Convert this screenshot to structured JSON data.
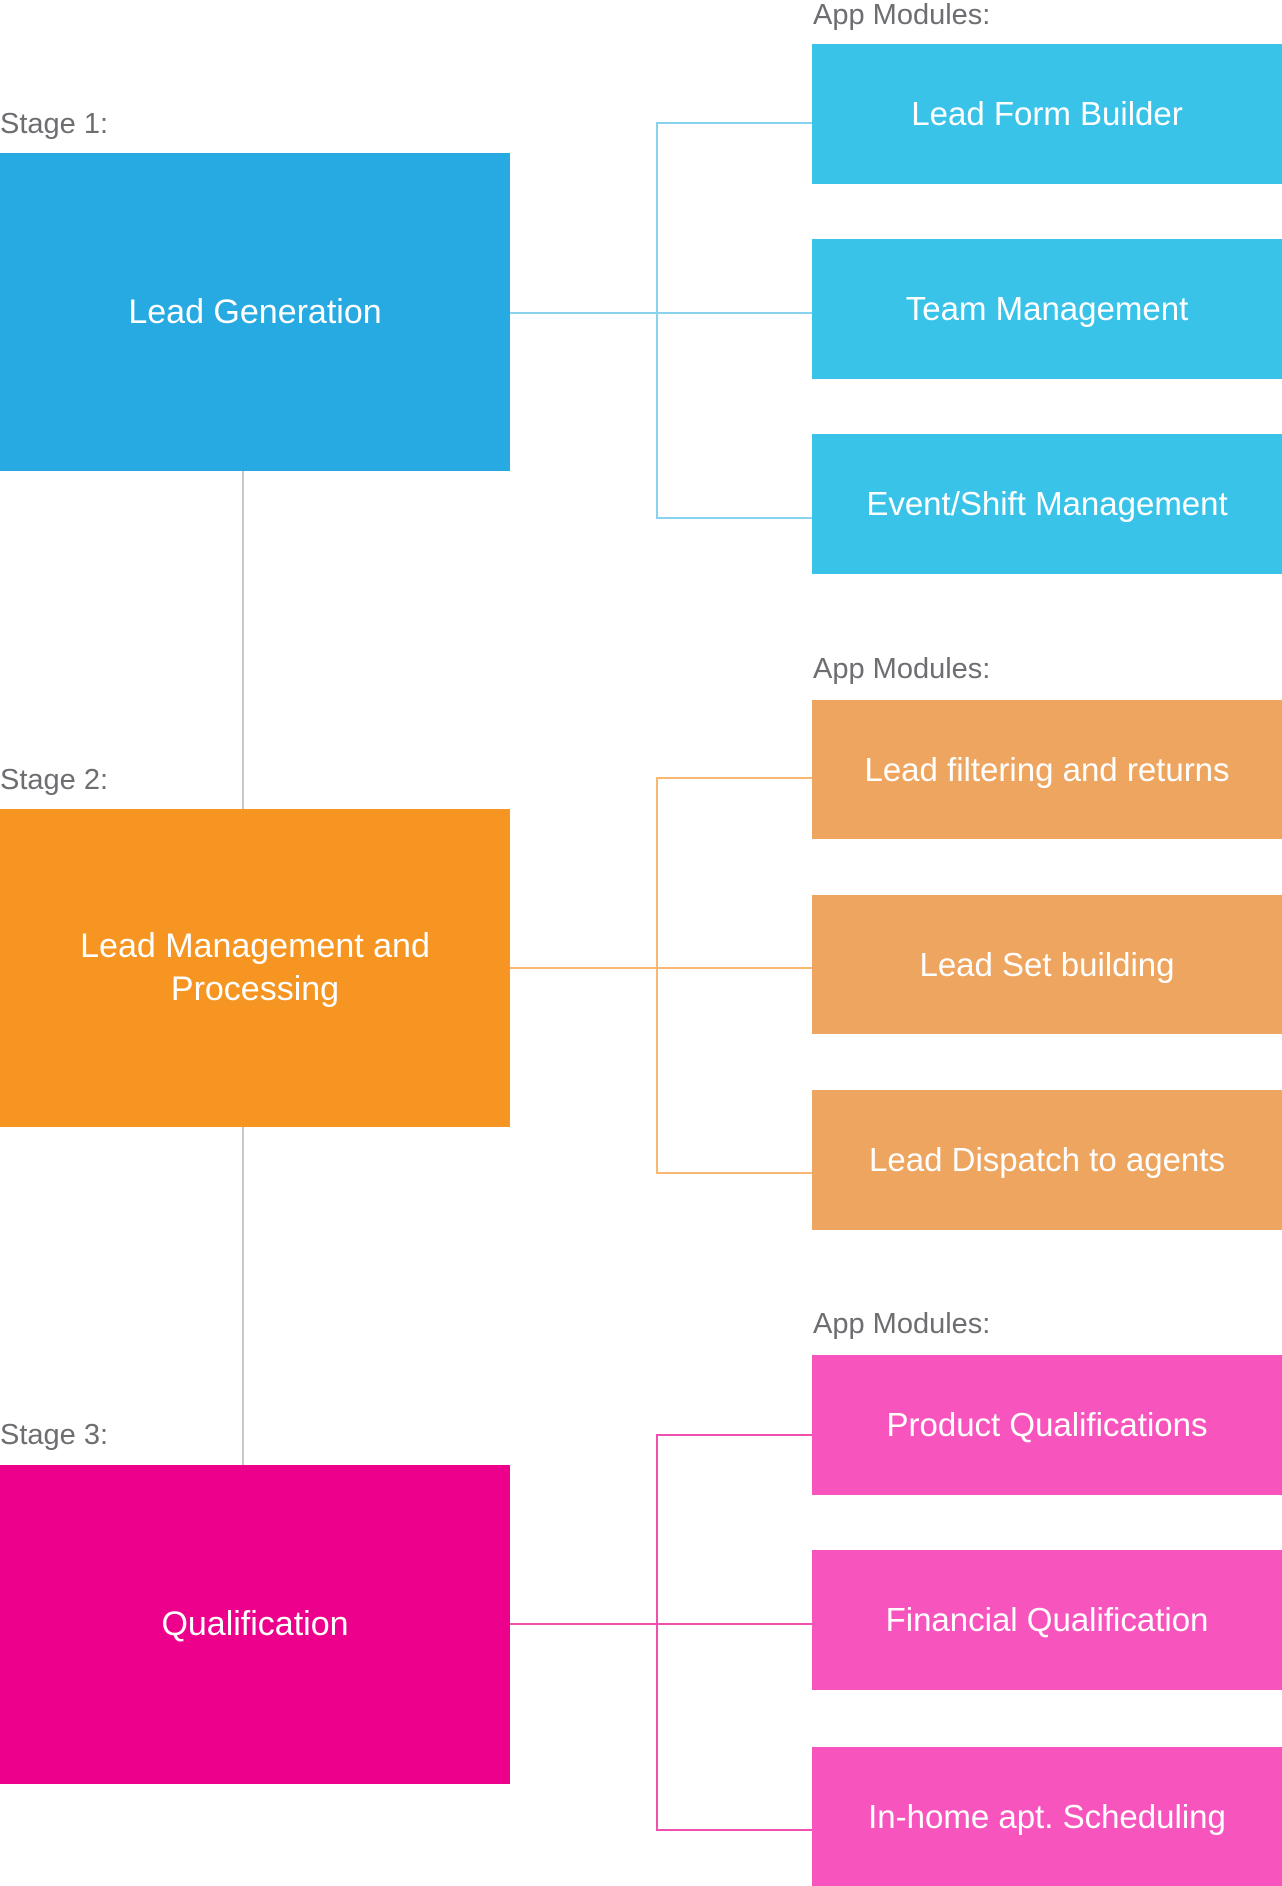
{
  "stages": [
    {
      "label": "Stage 1:",
      "title": "Lead Generation",
      "modules_label": "App Modules:",
      "modules": [
        "Lead Form Builder",
        "Team Management",
        "Event/Shift Management"
      ],
      "colors": {
        "stage": "#27a9e1",
        "module": "#3ac3e8",
        "connector": "#8ad3ef"
      }
    },
    {
      "label": "Stage 2:",
      "title": "Lead Management and Processing",
      "modules_label": "App Modules:",
      "modules": [
        "Lead filtering and returns",
        "Lead Set building",
        "Lead Dispatch to agents"
      ],
      "colors": {
        "stage": "#f69522",
        "module": "#eda55f",
        "connector": "#f8b870"
      }
    },
    {
      "label": "Stage 3:",
      "title": "Qualification",
      "modules_label": "App Modules:",
      "modules": [
        "Product Qualifications",
        "Financial Qualification",
        "In-home apt. Scheduling"
      ],
      "colors": {
        "stage": "#ec008c",
        "module": "#f755bd",
        "connector": "#f050b0"
      }
    }
  ],
  "stage_link_color": "#c8c8c8"
}
